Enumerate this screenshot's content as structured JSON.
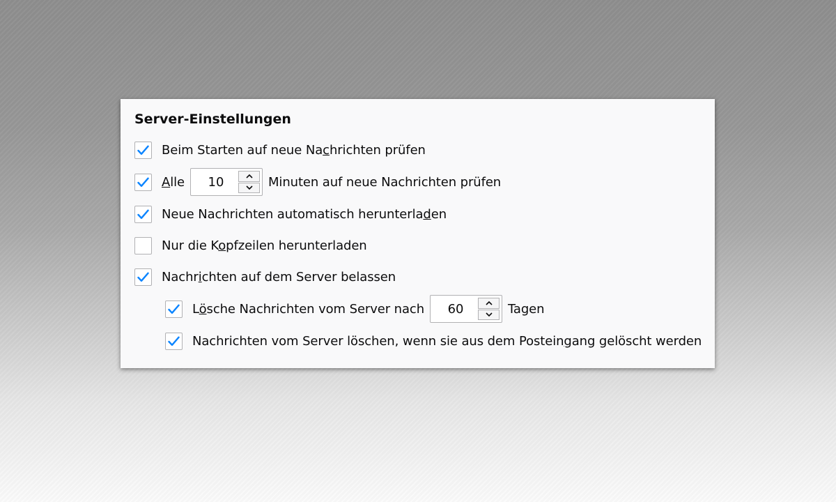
{
  "section": {
    "title": "Server-Einstellungen"
  },
  "options": {
    "check_on_startup": {
      "checked": true,
      "label_pre": "Beim Starten auf neue Na",
      "accesskey": "c",
      "label_post": "hrichten prüfen"
    },
    "check_every": {
      "checked": true,
      "label_pre": "",
      "accesskey": "A",
      "label_post": "lle",
      "minutes_value": "10",
      "label_after": "Minuten auf neue Nachrichten prüfen"
    },
    "auto_download": {
      "checked": true,
      "label_pre": "Neue Nachrichten automatisch herunterla",
      "accesskey": "d",
      "label_post": "en"
    },
    "headers_only": {
      "checked": false,
      "label_pre": "Nur die K",
      "accesskey": "o",
      "label_post": "pfzeilen herunterladen"
    },
    "leave_on_server": {
      "checked": true,
      "label_pre": "Nachr",
      "accesskey": "i",
      "label_post": "chten auf dem Server belassen"
    },
    "delete_after_days": {
      "checked": true,
      "label_pre": "L",
      "accesskey": "ö",
      "label_post": "sche Nachrichten vom Server nach",
      "days_value": "60",
      "label_after": "Tagen"
    },
    "delete_when_removed": {
      "checked": true,
      "label_pre": "Nachrichten vom Server löschen, wenn sie aus dem Postein",
      "accesskey": "g",
      "label_post": "ang gelöscht werden"
    }
  },
  "colors": {
    "checkmark": "#0a84ff",
    "panel_background": "#f9f9fa",
    "text": "#0c0c0d"
  },
  "icons": {
    "checkmark": "checkmark-icon",
    "spin_up": "chevron-up-icon",
    "spin_down": "chevron-down-icon"
  }
}
